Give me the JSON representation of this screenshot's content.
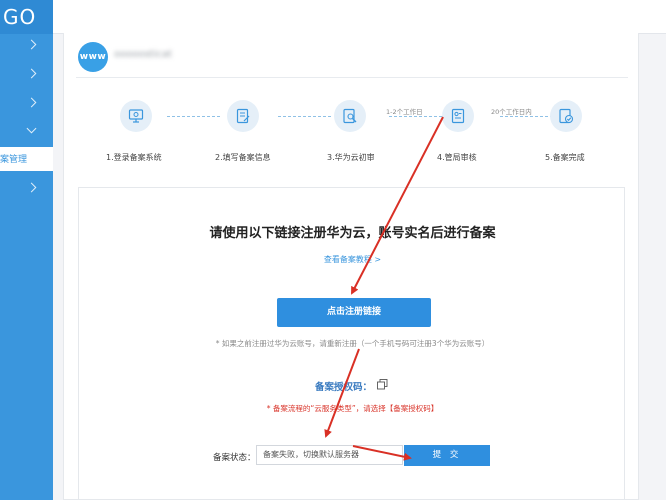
{
  "sidebar": {
    "logo_text": "GO",
    "active_item_label": "案管理"
  },
  "header": {
    "badge_text": "www",
    "domain_name": "ooooosticat"
  },
  "steps": [
    {
      "label": "1.登录备案系统",
      "icon": "monitor-gear-icon"
    },
    {
      "label": "2.填写备案信息",
      "icon": "document-edit-icon"
    },
    {
      "label": "3.华为云初审",
      "icon": "document-search-icon"
    },
    {
      "label": "4.管局审核",
      "icon": "id-card-icon"
    },
    {
      "label": "5.备案完成",
      "icon": "document-check-icon"
    }
  ],
  "step_durations": [
    "1-2个工作日",
    "20个工作日内"
  ],
  "content": {
    "title": "请使用以下链接注册华为云，账号实名后进行备案",
    "tutorial_link": "查看备案教程 >",
    "register_button": "点击注册链接",
    "hint": "* 如果之前注册过华为云账号，请重新注册（一个手机号码可注册3个华为云账号）",
    "auth_code_label": "备案授权码：",
    "warning": "* 备案流程的“云服务类型”，请选择【备案授权码】",
    "status_label": "备案状态：",
    "status_value": "备案失败，切换默认服务器",
    "submit_button": "提 交"
  },
  "colors": {
    "primary": "#2f8fdf",
    "sidebar": "#3a96dd",
    "warning": "#d9352b",
    "annotation_arrow": "#d93025"
  }
}
